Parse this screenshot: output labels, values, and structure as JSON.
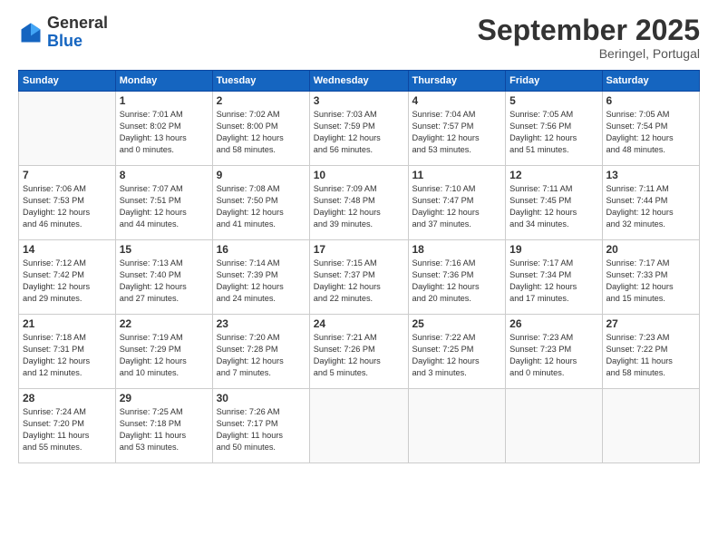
{
  "header": {
    "logo_general": "General",
    "logo_blue": "Blue",
    "month": "September 2025",
    "location": "Beringel, Portugal"
  },
  "weekdays": [
    "Sunday",
    "Monday",
    "Tuesday",
    "Wednesday",
    "Thursday",
    "Friday",
    "Saturday"
  ],
  "weeks": [
    [
      {
        "day": "",
        "info": ""
      },
      {
        "day": "1",
        "info": "Sunrise: 7:01 AM\nSunset: 8:02 PM\nDaylight: 13 hours\nand 0 minutes."
      },
      {
        "day": "2",
        "info": "Sunrise: 7:02 AM\nSunset: 8:00 PM\nDaylight: 12 hours\nand 58 minutes."
      },
      {
        "day": "3",
        "info": "Sunrise: 7:03 AM\nSunset: 7:59 PM\nDaylight: 12 hours\nand 56 minutes."
      },
      {
        "day": "4",
        "info": "Sunrise: 7:04 AM\nSunset: 7:57 PM\nDaylight: 12 hours\nand 53 minutes."
      },
      {
        "day": "5",
        "info": "Sunrise: 7:05 AM\nSunset: 7:56 PM\nDaylight: 12 hours\nand 51 minutes."
      },
      {
        "day": "6",
        "info": "Sunrise: 7:05 AM\nSunset: 7:54 PM\nDaylight: 12 hours\nand 48 minutes."
      }
    ],
    [
      {
        "day": "7",
        "info": "Sunrise: 7:06 AM\nSunset: 7:53 PM\nDaylight: 12 hours\nand 46 minutes."
      },
      {
        "day": "8",
        "info": "Sunrise: 7:07 AM\nSunset: 7:51 PM\nDaylight: 12 hours\nand 44 minutes."
      },
      {
        "day": "9",
        "info": "Sunrise: 7:08 AM\nSunset: 7:50 PM\nDaylight: 12 hours\nand 41 minutes."
      },
      {
        "day": "10",
        "info": "Sunrise: 7:09 AM\nSunset: 7:48 PM\nDaylight: 12 hours\nand 39 minutes."
      },
      {
        "day": "11",
        "info": "Sunrise: 7:10 AM\nSunset: 7:47 PM\nDaylight: 12 hours\nand 37 minutes."
      },
      {
        "day": "12",
        "info": "Sunrise: 7:11 AM\nSunset: 7:45 PM\nDaylight: 12 hours\nand 34 minutes."
      },
      {
        "day": "13",
        "info": "Sunrise: 7:11 AM\nSunset: 7:44 PM\nDaylight: 12 hours\nand 32 minutes."
      }
    ],
    [
      {
        "day": "14",
        "info": "Sunrise: 7:12 AM\nSunset: 7:42 PM\nDaylight: 12 hours\nand 29 minutes."
      },
      {
        "day": "15",
        "info": "Sunrise: 7:13 AM\nSunset: 7:40 PM\nDaylight: 12 hours\nand 27 minutes."
      },
      {
        "day": "16",
        "info": "Sunrise: 7:14 AM\nSunset: 7:39 PM\nDaylight: 12 hours\nand 24 minutes."
      },
      {
        "day": "17",
        "info": "Sunrise: 7:15 AM\nSunset: 7:37 PM\nDaylight: 12 hours\nand 22 minutes."
      },
      {
        "day": "18",
        "info": "Sunrise: 7:16 AM\nSunset: 7:36 PM\nDaylight: 12 hours\nand 20 minutes."
      },
      {
        "day": "19",
        "info": "Sunrise: 7:17 AM\nSunset: 7:34 PM\nDaylight: 12 hours\nand 17 minutes."
      },
      {
        "day": "20",
        "info": "Sunrise: 7:17 AM\nSunset: 7:33 PM\nDaylight: 12 hours\nand 15 minutes."
      }
    ],
    [
      {
        "day": "21",
        "info": "Sunrise: 7:18 AM\nSunset: 7:31 PM\nDaylight: 12 hours\nand 12 minutes."
      },
      {
        "day": "22",
        "info": "Sunrise: 7:19 AM\nSunset: 7:29 PM\nDaylight: 12 hours\nand 10 minutes."
      },
      {
        "day": "23",
        "info": "Sunrise: 7:20 AM\nSunset: 7:28 PM\nDaylight: 12 hours\nand 7 minutes."
      },
      {
        "day": "24",
        "info": "Sunrise: 7:21 AM\nSunset: 7:26 PM\nDaylight: 12 hours\nand 5 minutes."
      },
      {
        "day": "25",
        "info": "Sunrise: 7:22 AM\nSunset: 7:25 PM\nDaylight: 12 hours\nand 3 minutes."
      },
      {
        "day": "26",
        "info": "Sunrise: 7:23 AM\nSunset: 7:23 PM\nDaylight: 12 hours\nand 0 minutes."
      },
      {
        "day": "27",
        "info": "Sunrise: 7:23 AM\nSunset: 7:22 PM\nDaylight: 11 hours\nand 58 minutes."
      }
    ],
    [
      {
        "day": "28",
        "info": "Sunrise: 7:24 AM\nSunset: 7:20 PM\nDaylight: 11 hours\nand 55 minutes."
      },
      {
        "day": "29",
        "info": "Sunrise: 7:25 AM\nSunset: 7:18 PM\nDaylight: 11 hours\nand 53 minutes."
      },
      {
        "day": "30",
        "info": "Sunrise: 7:26 AM\nSunset: 7:17 PM\nDaylight: 11 hours\nand 50 minutes."
      },
      {
        "day": "",
        "info": ""
      },
      {
        "day": "",
        "info": ""
      },
      {
        "day": "",
        "info": ""
      },
      {
        "day": "",
        "info": ""
      }
    ]
  ]
}
